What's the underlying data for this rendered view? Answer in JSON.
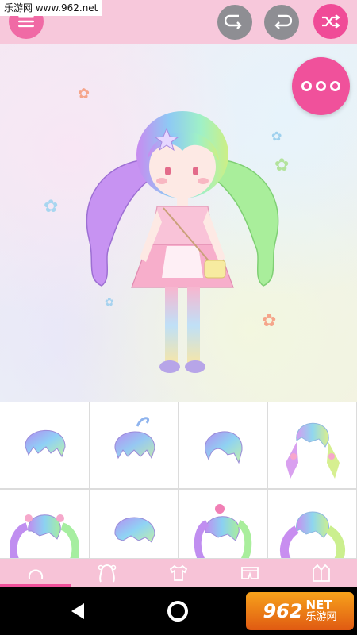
{
  "watermark": {
    "text": "乐游网 www.962.net"
  },
  "toolbar": {
    "menu_icon": "menu-icon",
    "undo_icon": "undo-icon",
    "redo_icon": "redo-icon",
    "shuffle_icon": "shuffle-icon"
  },
  "stage": {
    "more_icon": "more-icon"
  },
  "hair_grid": {
    "items": [
      {
        "style": "short-bob-bangs"
      },
      {
        "style": "short-bob-ahoge"
      },
      {
        "style": "side-swept-bob"
      },
      {
        "style": "twin-ribbons-long"
      },
      {
        "style": "twin-tails-bows"
      },
      {
        "style": "short-wavy"
      },
      {
        "style": "side-ponytail-bow"
      },
      {
        "style": "long-wavy-curls"
      }
    ]
  },
  "tabs": [
    {
      "icon": "hair-icon",
      "active": true
    },
    {
      "icon": "hair-back-icon",
      "active": false
    },
    {
      "icon": "shirt-icon",
      "active": false
    },
    {
      "icon": "shorts-icon",
      "active": false
    },
    {
      "icon": "jacket-icon",
      "active": false
    }
  ],
  "logo": {
    "number": "962",
    "net": "NET",
    "sub": "乐游网"
  },
  "colors": {
    "accent": "#f0519b",
    "topbar": "#f7c8db",
    "tabbar": "#f7c3d7",
    "disabled": "#8e8e93"
  }
}
